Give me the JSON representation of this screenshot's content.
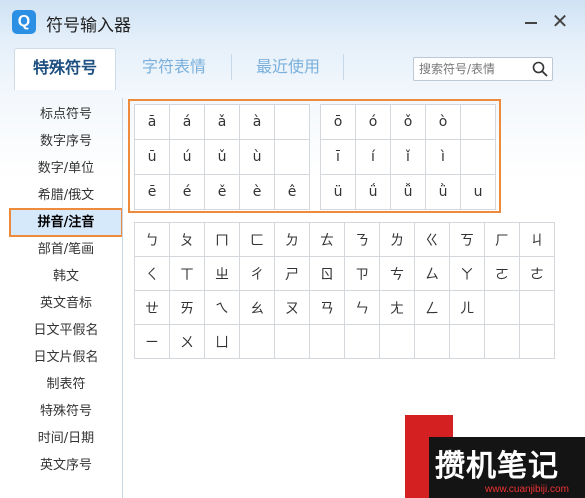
{
  "app": {
    "logo": "Q",
    "title": "符号输入器",
    "minimize_icon": "minimize-icon",
    "close_label": "✕"
  },
  "tabs": [
    {
      "label": "特殊符号",
      "active": true
    },
    {
      "label": "字符表情",
      "active": false
    },
    {
      "label": "最近使用",
      "active": false
    }
  ],
  "search": {
    "placeholder": "搜索符号/表情",
    "icon": "search-icon"
  },
  "sidebar": {
    "items": [
      {
        "label": "标点符号"
      },
      {
        "label": "数字序号"
      },
      {
        "label": "数字/单位"
      },
      {
        "label": "希腊/俄文"
      },
      {
        "label": "拼音/注音",
        "active": true
      },
      {
        "label": "部首/笔画"
      },
      {
        "label": "韩文"
      },
      {
        "label": "英文音标"
      },
      {
        "label": "日文平假名"
      },
      {
        "label": "日文片假名"
      },
      {
        "label": "制表符"
      },
      {
        "label": "特殊符号"
      },
      {
        "label": "时间/日期"
      },
      {
        "label": "英文序号"
      }
    ]
  },
  "pinyin_left": [
    [
      "ā",
      "á",
      "ǎ",
      "à",
      ""
    ],
    [
      "ū",
      "ú",
      "ǔ",
      "ù",
      ""
    ],
    [
      "ē",
      "é",
      "ě",
      "è",
      "ê"
    ]
  ],
  "pinyin_right": [
    [
      "ō",
      "ó",
      "ǒ",
      "ò",
      ""
    ],
    [
      "ī",
      "í",
      "ǐ",
      "ì",
      ""
    ],
    [
      "ü",
      "ǘ",
      "ǚ",
      "ǜ",
      "u"
    ]
  ],
  "zhuyin": [
    [
      "ㄅ",
      "ㄆ",
      "ㄇ",
      "ㄈ",
      "ㄉ",
      "ㄊ",
      "ㄋ",
      "ㄌ",
      "ㄍ",
      "ㄎ",
      "ㄏ",
      "ㄐ"
    ],
    [
      "ㄑ",
      "ㄒ",
      "ㄓ",
      "ㄔ",
      "ㄕ",
      "ㄖ",
      "ㄗ",
      "ㄘ",
      "ㄙ",
      "ㄚ",
      "ㄛ",
      "ㄜ"
    ],
    [
      "ㄝ",
      "ㄞ",
      "ㄟ",
      "ㄠ",
      "ㄡ",
      "ㄢ",
      "ㄣ",
      "ㄤ",
      "ㄥ",
      "ㄦ",
      "",
      ""
    ],
    [
      "ㄧ",
      "ㄨ",
      "ㄩ",
      "",
      "",
      "",
      "",
      "",
      "",
      "",
      "",
      ""
    ]
  ],
  "watermark": {
    "text": "攒机笔记",
    "url": "www.cuanjibiji.com"
  }
}
